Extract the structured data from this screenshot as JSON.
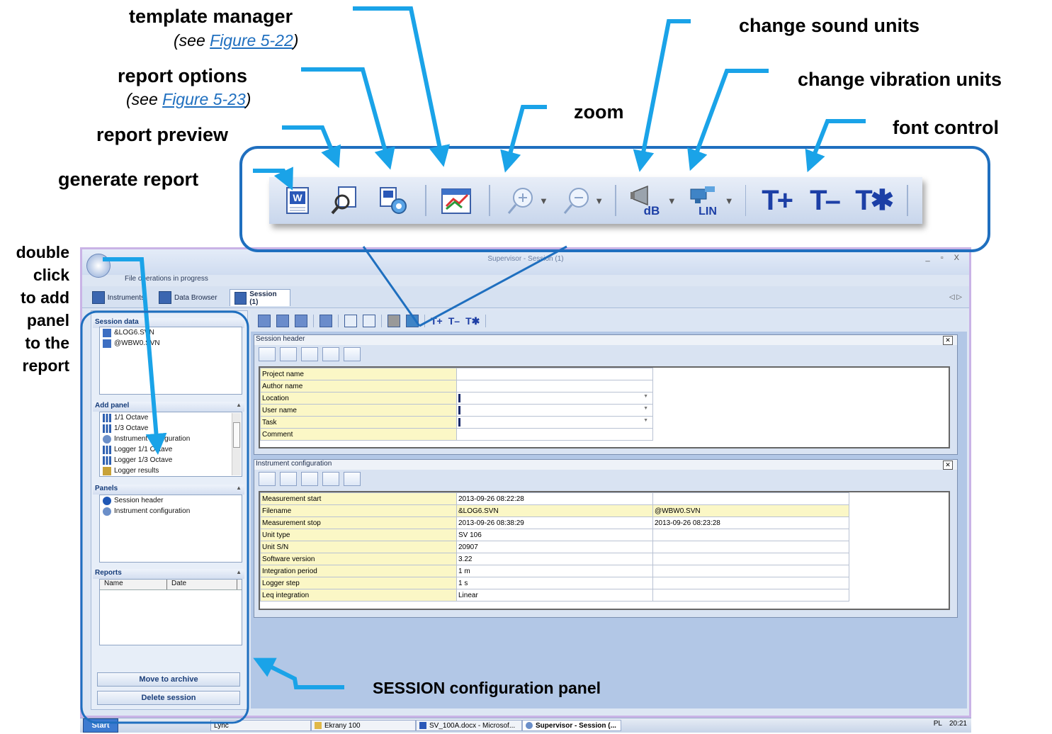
{
  "callouts": {
    "template_manager": "template manager",
    "template_manager_note_pre": "(see ",
    "template_manager_link": "Figure 5-22",
    "template_manager_note_post": ")",
    "report_options": "report options",
    "report_options_note_pre": "(see ",
    "report_options_link": "Figure 5-23",
    "report_options_note_post": ")",
    "report_preview": "report preview",
    "generate_report": "generate report",
    "zoom": "zoom",
    "change_sound_units": "change sound units",
    "change_vibration_units": "change vibration units",
    "font_control": "font control",
    "double_click_lines": [
      "double",
      "click",
      "to add",
      "panel",
      "to the",
      "report"
    ],
    "session_config_panel": "SESSION configuration panel"
  },
  "big_toolbar": {
    "font_buttons": [
      "T+",
      "T–",
      "T✱"
    ],
    "sound_unit": "dB",
    "vibration_unit": "LIN"
  },
  "window": {
    "title": "Supervisor - Session (1)",
    "status": "File operations in progress",
    "controls": "_ ▫ X",
    "tab_arrows": "◁ ▷",
    "tabs": [
      {
        "label": "Instruments"
      },
      {
        "label": "Data Browser"
      },
      {
        "label": "Session (1)"
      }
    ]
  },
  "left_panel": {
    "session_data": {
      "title": "Session data",
      "items": [
        "&LOG6.SVN",
        "@WBW0.SVN"
      ]
    },
    "add_panel": {
      "title": "Add panel",
      "items": [
        "1/1 Octave",
        "1/3 Octave",
        "Instrument configuration",
        "Logger 1/1 Octave",
        "Logger 1/3 Octave",
        "Logger results"
      ]
    },
    "panels": {
      "title": "Panels",
      "items": [
        "Session header",
        "Instrument configuration"
      ]
    },
    "reports": {
      "title": "Reports",
      "columns": [
        "Name",
        "Date"
      ]
    },
    "buttons": {
      "move_to_archive": "Move to archive",
      "delete_session": "Delete session"
    }
  },
  "session_header": {
    "title": "Session header",
    "rows": [
      {
        "label": "Project name",
        "value": ""
      },
      {
        "label": "Author name",
        "value": ""
      },
      {
        "label": "Location",
        "value": ""
      },
      {
        "label": "User name",
        "value": ""
      },
      {
        "label": "Task",
        "value": ""
      },
      {
        "label": "Comment",
        "value": ""
      }
    ]
  },
  "instrument_configuration": {
    "title": "Instrument configuration",
    "rows": [
      {
        "label": "Measurement start",
        "v1": "2013-09-26 08:22:28",
        "v2": ""
      },
      {
        "label": "Filename",
        "v1": "&LOG6.SVN",
        "v2": "@WBW0.SVN"
      },
      {
        "label": "Measurement stop",
        "v1": "2013-09-26 08:38:29",
        "v2": "2013-09-26 08:23:28"
      },
      {
        "label": "Unit type",
        "v1": "SV 106",
        "v2": ""
      },
      {
        "label": "Unit S/N",
        "v1": "20907",
        "v2": ""
      },
      {
        "label": "Software version",
        "v1": "3.22",
        "v2": ""
      },
      {
        "label": "Integration period",
        "v1": "1 m",
        "v2": ""
      },
      {
        "label": "Logger step",
        "v1": "1 s",
        "v2": ""
      },
      {
        "label": "Leq integration",
        "v1": "Linear",
        "v2": ""
      }
    ]
  },
  "taskbar": {
    "start": "Start",
    "items": [
      "Lync",
      "Ekrany 100",
      "SV_100A.docx - Microsof...",
      "Supervisor - Session (..."
    ],
    "lang": "PL",
    "time": "20:21"
  }
}
